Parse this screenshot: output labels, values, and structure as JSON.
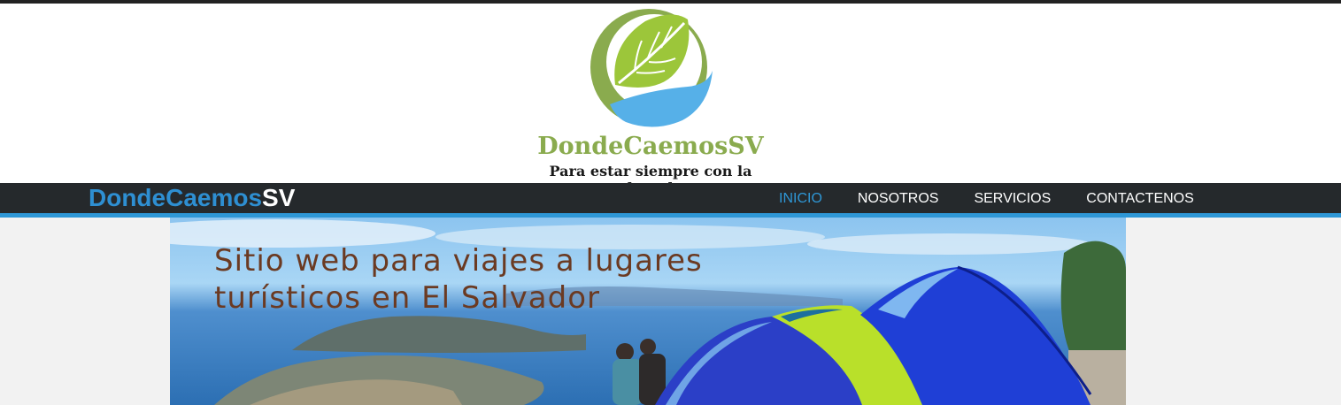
{
  "logo": {
    "name": "DondeCaemosSV",
    "slogan": "Para estar siempre con la cherada",
    "colors": {
      "green": "#8aab4e",
      "leaf": "#9cc63a",
      "blue": "#56b0e8"
    }
  },
  "navbar": {
    "brand_part1": "DondeCaemos",
    "brand_part2": "SV",
    "items": [
      {
        "label": "INICIO",
        "active": true
      },
      {
        "label": "NOSOTROS",
        "active": false
      },
      {
        "label": "SERVICIOS",
        "active": false
      },
      {
        "label": "CONTACTENOS",
        "active": false
      }
    ],
    "accent": "#2e97d6"
  },
  "hero": {
    "title_line1": "Sitio web para viajes a lugares",
    "title_line2": "turísticos en El Salvador"
  }
}
